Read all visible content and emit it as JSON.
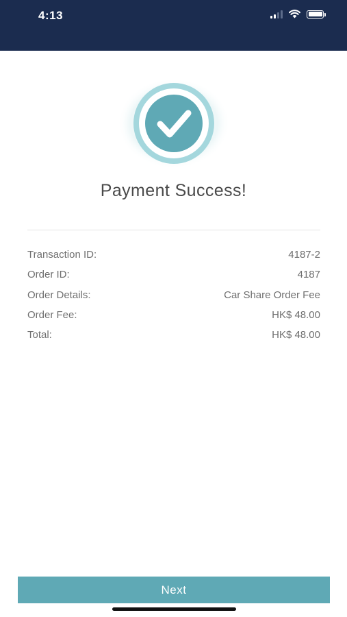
{
  "status_bar": {
    "time": "4:13",
    "icons": [
      "cellular-signal-icon",
      "wifi-icon",
      "battery-icon"
    ],
    "background_color": "#1b2c4f"
  },
  "success": {
    "icon": "checkmark-circle-icon",
    "title": "Payment Success!",
    "accent_color": "#5fa9b5"
  },
  "details": {
    "rows": [
      {
        "label": "Transaction ID:",
        "value": "4187-2"
      },
      {
        "label": "Order ID:",
        "value": "4187"
      },
      {
        "label": "Order Details:",
        "value": "Car Share Order Fee"
      },
      {
        "label": "Order Fee:",
        "value": "HK$ 48.00"
      },
      {
        "label": "Total:",
        "value": "HK$ 48.00"
      }
    ]
  },
  "footer": {
    "next_label": "Next"
  }
}
